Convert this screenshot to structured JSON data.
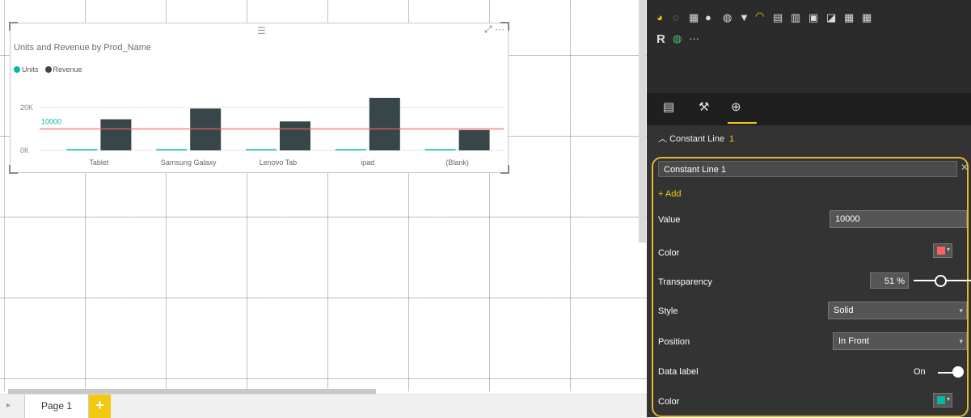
{
  "canvas": {
    "page_tab": "Page 1",
    "add_tab_symbol": "+"
  },
  "visual": {
    "title": "Units and Revenue by Prod_Name",
    "legend": [
      {
        "name": "Units",
        "color": "#01b8aa"
      },
      {
        "name": "Revenue",
        "color": "#374649"
      }
    ]
  },
  "chart_data": {
    "type": "bar",
    "categories": [
      "Tablet",
      "Samsung Galaxy",
      "Lenovo Tab",
      "ipad",
      "(Blank)"
    ],
    "series": [
      {
        "name": "Units",
        "values": [
          3,
          3,
          3,
          3,
          3
        ],
        "color": "#01b8aa"
      },
      {
        "name": "Revenue",
        "values": [
          14500,
          19500,
          13500,
          24500,
          9500
        ],
        "color": "#374649"
      }
    ],
    "ytick_labels": [
      "0K",
      "20K"
    ],
    "ylim": [
      0,
      26000
    ],
    "constant_line": {
      "value": 10000,
      "label": "10000",
      "color": "#fd625e",
      "label_color": "#01b8aa"
    }
  },
  "pane": {
    "tabs": [
      "fields",
      "format",
      "analytics"
    ],
    "section_title": "Constant Line",
    "section_count": "1",
    "line_name": "Constant Line 1",
    "add_label": "Add",
    "value_label": "Value",
    "value": "10000",
    "color_label": "Color",
    "line_color": "#fd625e",
    "transparency_label": "Transparency",
    "transparency_value": "51",
    "transparency_unit": "%",
    "style_label": "Style",
    "style_value": "Solid",
    "position_label": "Position",
    "position_value": "In Front",
    "data_label_label": "Data label",
    "data_label_state": "On",
    "label_color_label": "Color",
    "label_color": "#01b8aa"
  },
  "viz_icons": {
    "r_label": "R",
    "more": "···"
  }
}
